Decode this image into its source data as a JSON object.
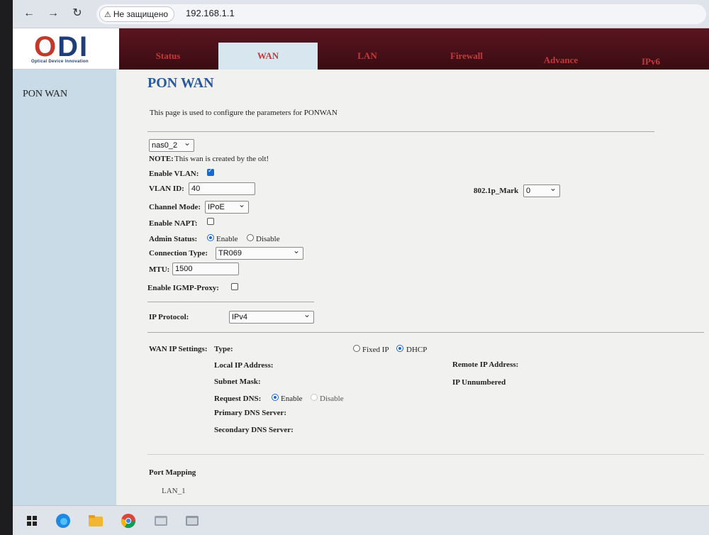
{
  "browser": {
    "security_label": "Не защищено",
    "url": "192.168.1.1"
  },
  "logo": {
    "brand_o": "O",
    "brand_di": "DI",
    "tagline": "Optical Device Innovation"
  },
  "nav": {
    "tabs": [
      {
        "label": "Status"
      },
      {
        "label": "WAN"
      },
      {
        "label": "LAN"
      },
      {
        "label": "Firewall"
      },
      {
        "label": "Advance"
      },
      {
        "label": "IPv6"
      }
    ],
    "active": "WAN"
  },
  "sidebar": {
    "items": [
      {
        "label": "PON WAN"
      }
    ]
  },
  "page": {
    "title": "PON WAN",
    "description": "This page is used to configure the parameters for PONWAN"
  },
  "form": {
    "wan_select": "nas0_2",
    "note_label": "NOTE:",
    "note_text": "This wan is created by the olt!",
    "enable_vlan_label": "Enable VLAN:",
    "enable_vlan": true,
    "vlan_id_label": "VLAN ID:",
    "vlan_id": "40",
    "mark_label": "802.1p_Mark",
    "mark_value": "0",
    "channel_mode_label": "Channel Mode:",
    "channel_mode": "IPoE",
    "enable_napt_label": "Enable NAPT:",
    "enable_napt": false,
    "admin_status_label": "Admin Status:",
    "admin_enable": "Enable",
    "admin_disable": "Disable",
    "connection_type_label": "Connection Type:",
    "connection_type": "TR069",
    "mtu_label": "MTU:",
    "mtu": "1500",
    "igmp_label": "Enable IGMP-Proxy:",
    "igmp": false,
    "ip_protocol_label": "IP Protocol:",
    "ip_protocol": "IPv4",
    "wan_ip_settings_label": "WAN IP Settings:",
    "type_label": "Type:",
    "fixed_ip": "Fixed IP",
    "dhcp": "DHCP",
    "local_ip_label": "Local IP Address:",
    "remote_ip_label": "Remote IP Address:",
    "subnet_mask_label": "Subnet Mask:",
    "ip_unnumbered_label": "IP Unnumbered",
    "request_dns_label": "Request DNS:",
    "dns_enable": "Enable",
    "dns_disable": "Disable",
    "primary_dns_label": "Primary DNS Server:",
    "secondary_dns_label": "Secondary DNS Server:",
    "port_mapping_label": "Port Mapping",
    "lan1_label": "LAN_1"
  },
  "colors": {
    "nav_bg": "#4a1018",
    "tab_text": "#c23a3a",
    "active_tab_bg": "#d8e7ef",
    "title_blue": "#2a5a9c",
    "accent": "#1a66d2"
  }
}
